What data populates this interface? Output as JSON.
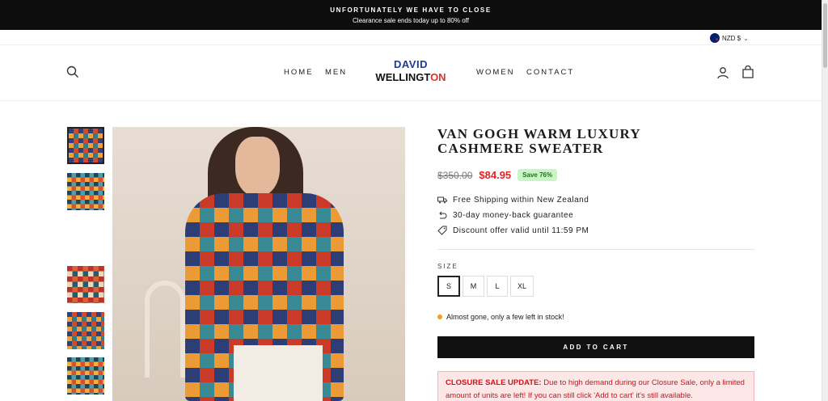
{
  "announcement": {
    "headline": "UNFORTUNATELY WE HAVE TO CLOSE",
    "subline": "Clearance sale ends today up to 80% off"
  },
  "currency": {
    "label": "NZD $"
  },
  "nav": {
    "left": [
      "HOME",
      "MEN"
    ],
    "right": [
      "WOMEN",
      "CONTACT"
    ]
  },
  "logo": {
    "line1": "DAVID",
    "line2_a": "WELLINGT",
    "line2_b": "ON"
  },
  "product": {
    "title": "VAN GOGH WARM LUXURY CASHMERE SWEATER",
    "price_old": "$350.00",
    "price_new": "$84.95",
    "save_badge": "Save 76%",
    "features": [
      "Free Shipping within New Zealand",
      "30-day money-back guarantee",
      "Discount offer valid until 11:59 PM"
    ],
    "size_label": "SIZE",
    "sizes": [
      "S",
      "M",
      "L",
      "XL"
    ],
    "selected_size": "S",
    "stock_text": "Almost gone, only a few left in stock!",
    "add_to_cart": "ADD TO CART",
    "notice_title": "CLOSURE SALE UPDATE:",
    "notice_body": " Due to high demand during our Closure Sale, only a limited amount of units are left! If you can still click 'Add to cart' it's still available."
  },
  "icons": {
    "search": "search-icon",
    "account": "account-icon",
    "cart": "cart-icon",
    "shipping": "truck-icon",
    "return": "return-arrow-icon",
    "discount": "tag-icon"
  },
  "colors": {
    "announcement_bg": "#0d0d0d",
    "sale_price": "#e02323",
    "save_badge_bg": "#c8f5c4",
    "notice_bg": "#fde6e6",
    "cta_bg": "#111111"
  }
}
